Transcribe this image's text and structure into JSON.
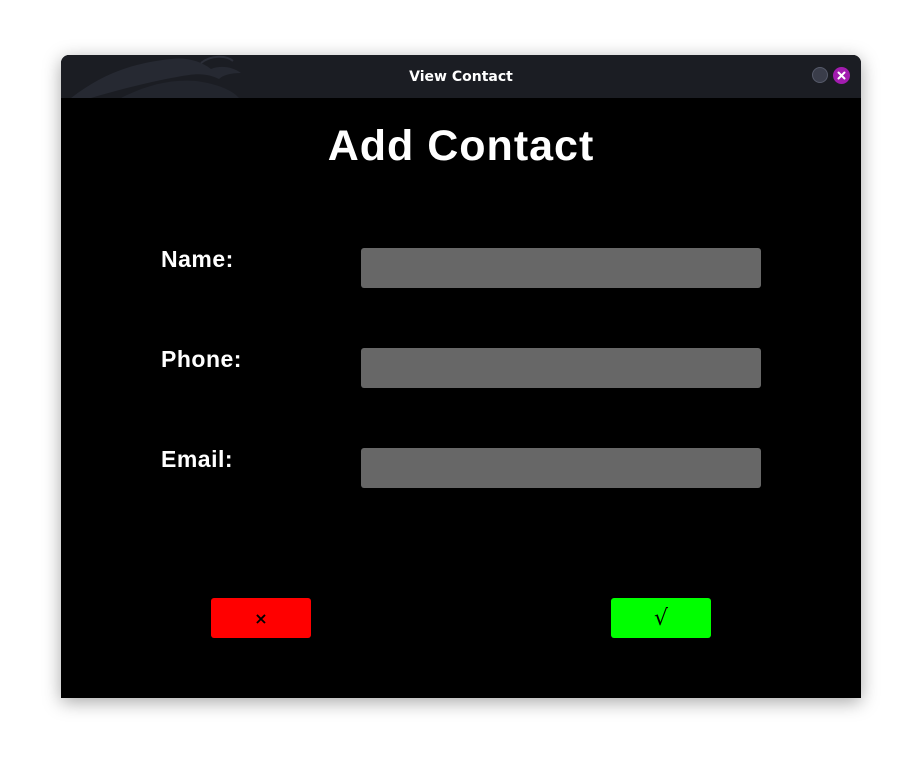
{
  "window": {
    "title": "View Contact"
  },
  "form": {
    "heading": "Add Contact",
    "fields": [
      {
        "label": "Name:",
        "value": "",
        "placeholder": ""
      },
      {
        "label": "Phone:",
        "value": "",
        "placeholder": ""
      },
      {
        "label": "Email:",
        "value": "",
        "placeholder": ""
      }
    ]
  },
  "buttons": {
    "cancel_label": "×",
    "confirm_label": "√"
  },
  "icons": {
    "window_background": "dragon-icon",
    "minimize": "minimize-icon",
    "close": "close-icon"
  },
  "colors": {
    "titlebar": "#1b1d23",
    "background": "#000000",
    "input": "#676767",
    "cancel": "#ff0000",
    "confirm": "#00ff00",
    "close_button": "#a21caf"
  }
}
